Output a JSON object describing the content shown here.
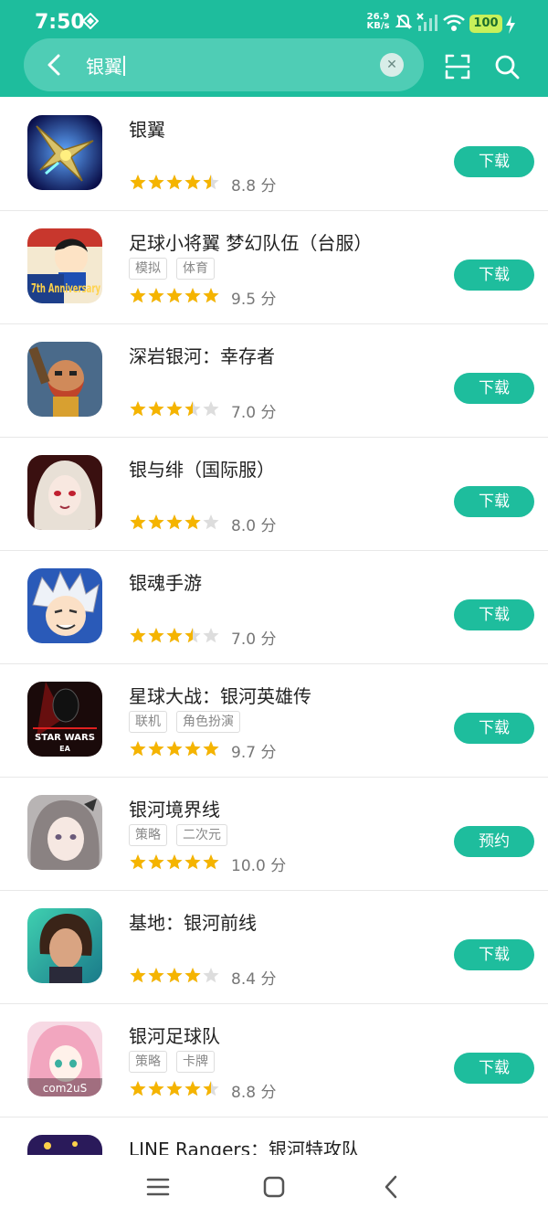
{
  "status": {
    "time": "7:50",
    "net_speed_value": "26.9",
    "net_speed_unit": "KB/s",
    "battery": "100"
  },
  "search": {
    "query": "银翼",
    "icons": [
      "back-icon",
      "clear-icon",
      "scan-icon",
      "search-icon"
    ]
  },
  "colors": {
    "accent": "#1ebd9d",
    "star": "#f5b400",
    "star_empty": "#dddddd"
  },
  "apps": [
    {
      "name": "银翼",
      "tags": [],
      "rating": 4.5,
      "score": "8.8 分",
      "button": "下载"
    },
    {
      "name": "足球小将翼 梦幻队伍（台服）",
      "tags": [
        "模拟",
        "体育"
      ],
      "rating": 5,
      "score": "9.5 分",
      "button": "下载"
    },
    {
      "name": "深岩银河：幸存者",
      "tags": [],
      "rating": 3.5,
      "score": "7.0 分",
      "button": "下载"
    },
    {
      "name": "银与绯（国际服）",
      "tags": [],
      "rating": 4,
      "score": "8.0 分",
      "button": "下载"
    },
    {
      "name": "银魂手游",
      "tags": [],
      "rating": 3.5,
      "score": "7.0 分",
      "button": "下载"
    },
    {
      "name": "星球大战：银河英雄传",
      "tags": [
        "联机",
        "角色扮演"
      ],
      "rating": 5,
      "score": "9.7 分",
      "button": "下载"
    },
    {
      "name": "银河境界线",
      "tags": [
        "策略",
        "二次元"
      ],
      "rating": 5,
      "score": "10.0 分",
      "button": "预约"
    },
    {
      "name": "基地：银河前线",
      "tags": [],
      "rating": 4,
      "score": "8.4 分",
      "button": "下载"
    },
    {
      "name": "银河足球队",
      "tags": [
        "策略",
        "卡牌"
      ],
      "rating": 4.5,
      "score": "8.8 分",
      "button": "下载"
    },
    {
      "name": "LINE Rangers：银河特攻队",
      "tags": [],
      "rating": 0,
      "score": "",
      "button": ""
    }
  ],
  "app_icon_text": {
    "captain_tsubasa": "7th Anniversary",
    "star_wars": "STAR WARS",
    "star_wars_sub": "EA",
    "galaxy_soccer": "com2uS"
  },
  "navbar": {
    "icons": [
      "menu-icon",
      "home-icon",
      "back-nav-icon"
    ]
  }
}
